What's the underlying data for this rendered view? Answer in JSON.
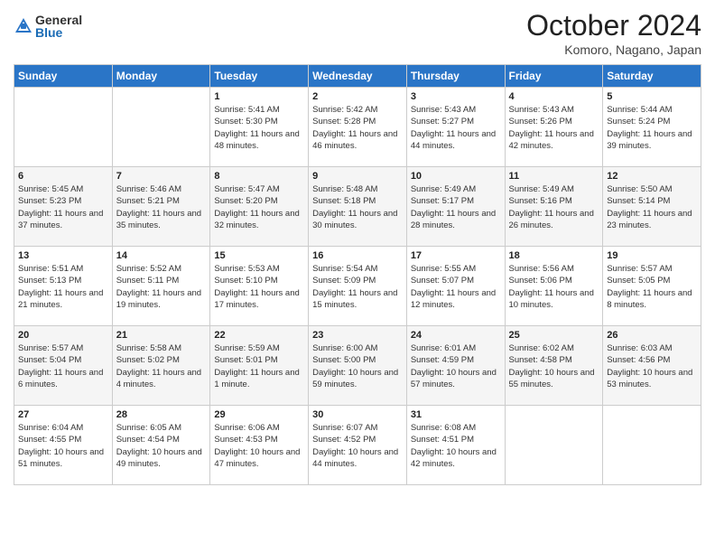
{
  "logo": {
    "general": "General",
    "blue": "Blue"
  },
  "header": {
    "month": "October 2024",
    "location": "Komoro, Nagano, Japan"
  },
  "days_of_week": [
    "Sunday",
    "Monday",
    "Tuesday",
    "Wednesday",
    "Thursday",
    "Friday",
    "Saturday"
  ],
  "weeks": [
    [
      {
        "day": "",
        "info": ""
      },
      {
        "day": "",
        "info": ""
      },
      {
        "day": "1",
        "info": "Sunrise: 5:41 AM\nSunset: 5:30 PM\nDaylight: 11 hours and 48 minutes."
      },
      {
        "day": "2",
        "info": "Sunrise: 5:42 AM\nSunset: 5:28 PM\nDaylight: 11 hours and 46 minutes."
      },
      {
        "day": "3",
        "info": "Sunrise: 5:43 AM\nSunset: 5:27 PM\nDaylight: 11 hours and 44 minutes."
      },
      {
        "day": "4",
        "info": "Sunrise: 5:43 AM\nSunset: 5:26 PM\nDaylight: 11 hours and 42 minutes."
      },
      {
        "day": "5",
        "info": "Sunrise: 5:44 AM\nSunset: 5:24 PM\nDaylight: 11 hours and 39 minutes."
      }
    ],
    [
      {
        "day": "6",
        "info": "Sunrise: 5:45 AM\nSunset: 5:23 PM\nDaylight: 11 hours and 37 minutes."
      },
      {
        "day": "7",
        "info": "Sunrise: 5:46 AM\nSunset: 5:21 PM\nDaylight: 11 hours and 35 minutes."
      },
      {
        "day": "8",
        "info": "Sunrise: 5:47 AM\nSunset: 5:20 PM\nDaylight: 11 hours and 32 minutes."
      },
      {
        "day": "9",
        "info": "Sunrise: 5:48 AM\nSunset: 5:18 PM\nDaylight: 11 hours and 30 minutes."
      },
      {
        "day": "10",
        "info": "Sunrise: 5:49 AM\nSunset: 5:17 PM\nDaylight: 11 hours and 28 minutes."
      },
      {
        "day": "11",
        "info": "Sunrise: 5:49 AM\nSunset: 5:16 PM\nDaylight: 11 hours and 26 minutes."
      },
      {
        "day": "12",
        "info": "Sunrise: 5:50 AM\nSunset: 5:14 PM\nDaylight: 11 hours and 23 minutes."
      }
    ],
    [
      {
        "day": "13",
        "info": "Sunrise: 5:51 AM\nSunset: 5:13 PM\nDaylight: 11 hours and 21 minutes."
      },
      {
        "day": "14",
        "info": "Sunrise: 5:52 AM\nSunset: 5:11 PM\nDaylight: 11 hours and 19 minutes."
      },
      {
        "day": "15",
        "info": "Sunrise: 5:53 AM\nSunset: 5:10 PM\nDaylight: 11 hours and 17 minutes."
      },
      {
        "day": "16",
        "info": "Sunrise: 5:54 AM\nSunset: 5:09 PM\nDaylight: 11 hours and 15 minutes."
      },
      {
        "day": "17",
        "info": "Sunrise: 5:55 AM\nSunset: 5:07 PM\nDaylight: 11 hours and 12 minutes."
      },
      {
        "day": "18",
        "info": "Sunrise: 5:56 AM\nSunset: 5:06 PM\nDaylight: 11 hours and 10 minutes."
      },
      {
        "day": "19",
        "info": "Sunrise: 5:57 AM\nSunset: 5:05 PM\nDaylight: 11 hours and 8 minutes."
      }
    ],
    [
      {
        "day": "20",
        "info": "Sunrise: 5:57 AM\nSunset: 5:04 PM\nDaylight: 11 hours and 6 minutes."
      },
      {
        "day": "21",
        "info": "Sunrise: 5:58 AM\nSunset: 5:02 PM\nDaylight: 11 hours and 4 minutes."
      },
      {
        "day": "22",
        "info": "Sunrise: 5:59 AM\nSunset: 5:01 PM\nDaylight: 11 hours and 1 minute."
      },
      {
        "day": "23",
        "info": "Sunrise: 6:00 AM\nSunset: 5:00 PM\nDaylight: 10 hours and 59 minutes."
      },
      {
        "day": "24",
        "info": "Sunrise: 6:01 AM\nSunset: 4:59 PM\nDaylight: 10 hours and 57 minutes."
      },
      {
        "day": "25",
        "info": "Sunrise: 6:02 AM\nSunset: 4:58 PM\nDaylight: 10 hours and 55 minutes."
      },
      {
        "day": "26",
        "info": "Sunrise: 6:03 AM\nSunset: 4:56 PM\nDaylight: 10 hours and 53 minutes."
      }
    ],
    [
      {
        "day": "27",
        "info": "Sunrise: 6:04 AM\nSunset: 4:55 PM\nDaylight: 10 hours and 51 minutes."
      },
      {
        "day": "28",
        "info": "Sunrise: 6:05 AM\nSunset: 4:54 PM\nDaylight: 10 hours and 49 minutes."
      },
      {
        "day": "29",
        "info": "Sunrise: 6:06 AM\nSunset: 4:53 PM\nDaylight: 10 hours and 47 minutes."
      },
      {
        "day": "30",
        "info": "Sunrise: 6:07 AM\nSunset: 4:52 PM\nDaylight: 10 hours and 44 minutes."
      },
      {
        "day": "31",
        "info": "Sunrise: 6:08 AM\nSunset: 4:51 PM\nDaylight: 10 hours and 42 minutes."
      },
      {
        "day": "",
        "info": ""
      },
      {
        "day": "",
        "info": ""
      }
    ]
  ]
}
